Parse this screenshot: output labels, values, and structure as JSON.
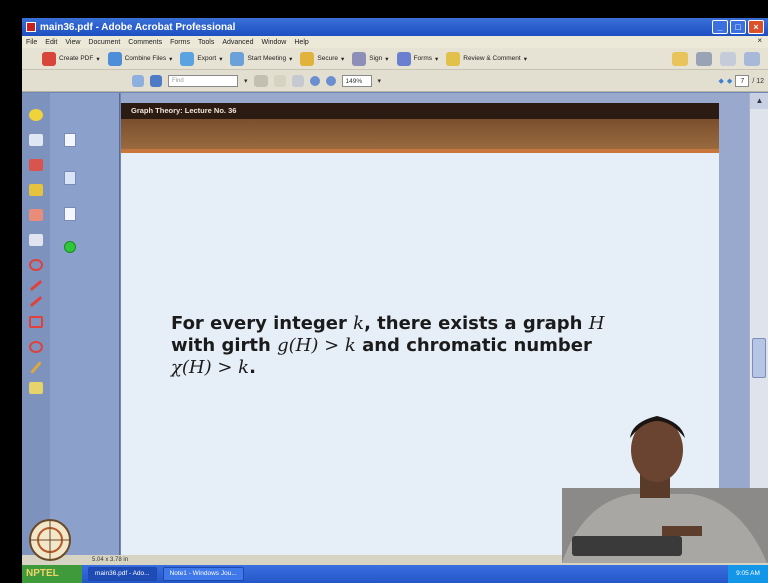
{
  "window": {
    "title": "main36.pdf - Adobe Acrobat Professional",
    "controls": [
      "_",
      "□",
      "×"
    ]
  },
  "menu": [
    "File",
    "Edit",
    "View",
    "Document",
    "Comments",
    "Forms",
    "Tools",
    "Advanced",
    "Window",
    "Help"
  ],
  "toolbar": {
    "create_pdf": "Create PDF",
    "combine_files": "Combine Files",
    "export": "Export",
    "start_meeting": "Start Meeting",
    "secure": "Secure",
    "sign": "Sign",
    "forms": "Forms",
    "review_comment": "Review & Comment"
  },
  "nav_toolbar": {
    "find_placeholder": "Find",
    "zoom": "149%",
    "current_page": "7",
    "total_pages": "/ 12"
  },
  "slide": {
    "header": "Graph Theory: Lecture No. 36",
    "line1_a": "For every integer ",
    "line1_k": "k",
    "line1_b": ", there exists a graph ",
    "line1_h": "H",
    "line2_a": "with girth ",
    "line2_math": "g(H) > k",
    "line2_b": " and chromatic number",
    "line3_math": "χ(H) > k",
    "line3_b": "."
  },
  "status": {
    "page_size": "5.04 x 3.78 in"
  },
  "taskbar": {
    "start_label": "NPTEL",
    "task1": "main36.pdf - Ado...",
    "task2": "Note1 - Windows Jou...",
    "clock": "9:05 AM"
  },
  "colors": {
    "slide_bg": "#e6eef7",
    "header_bg": "#2b1b12",
    "band": "#8a5b34",
    "titlebar": "#2a5fd0"
  }
}
